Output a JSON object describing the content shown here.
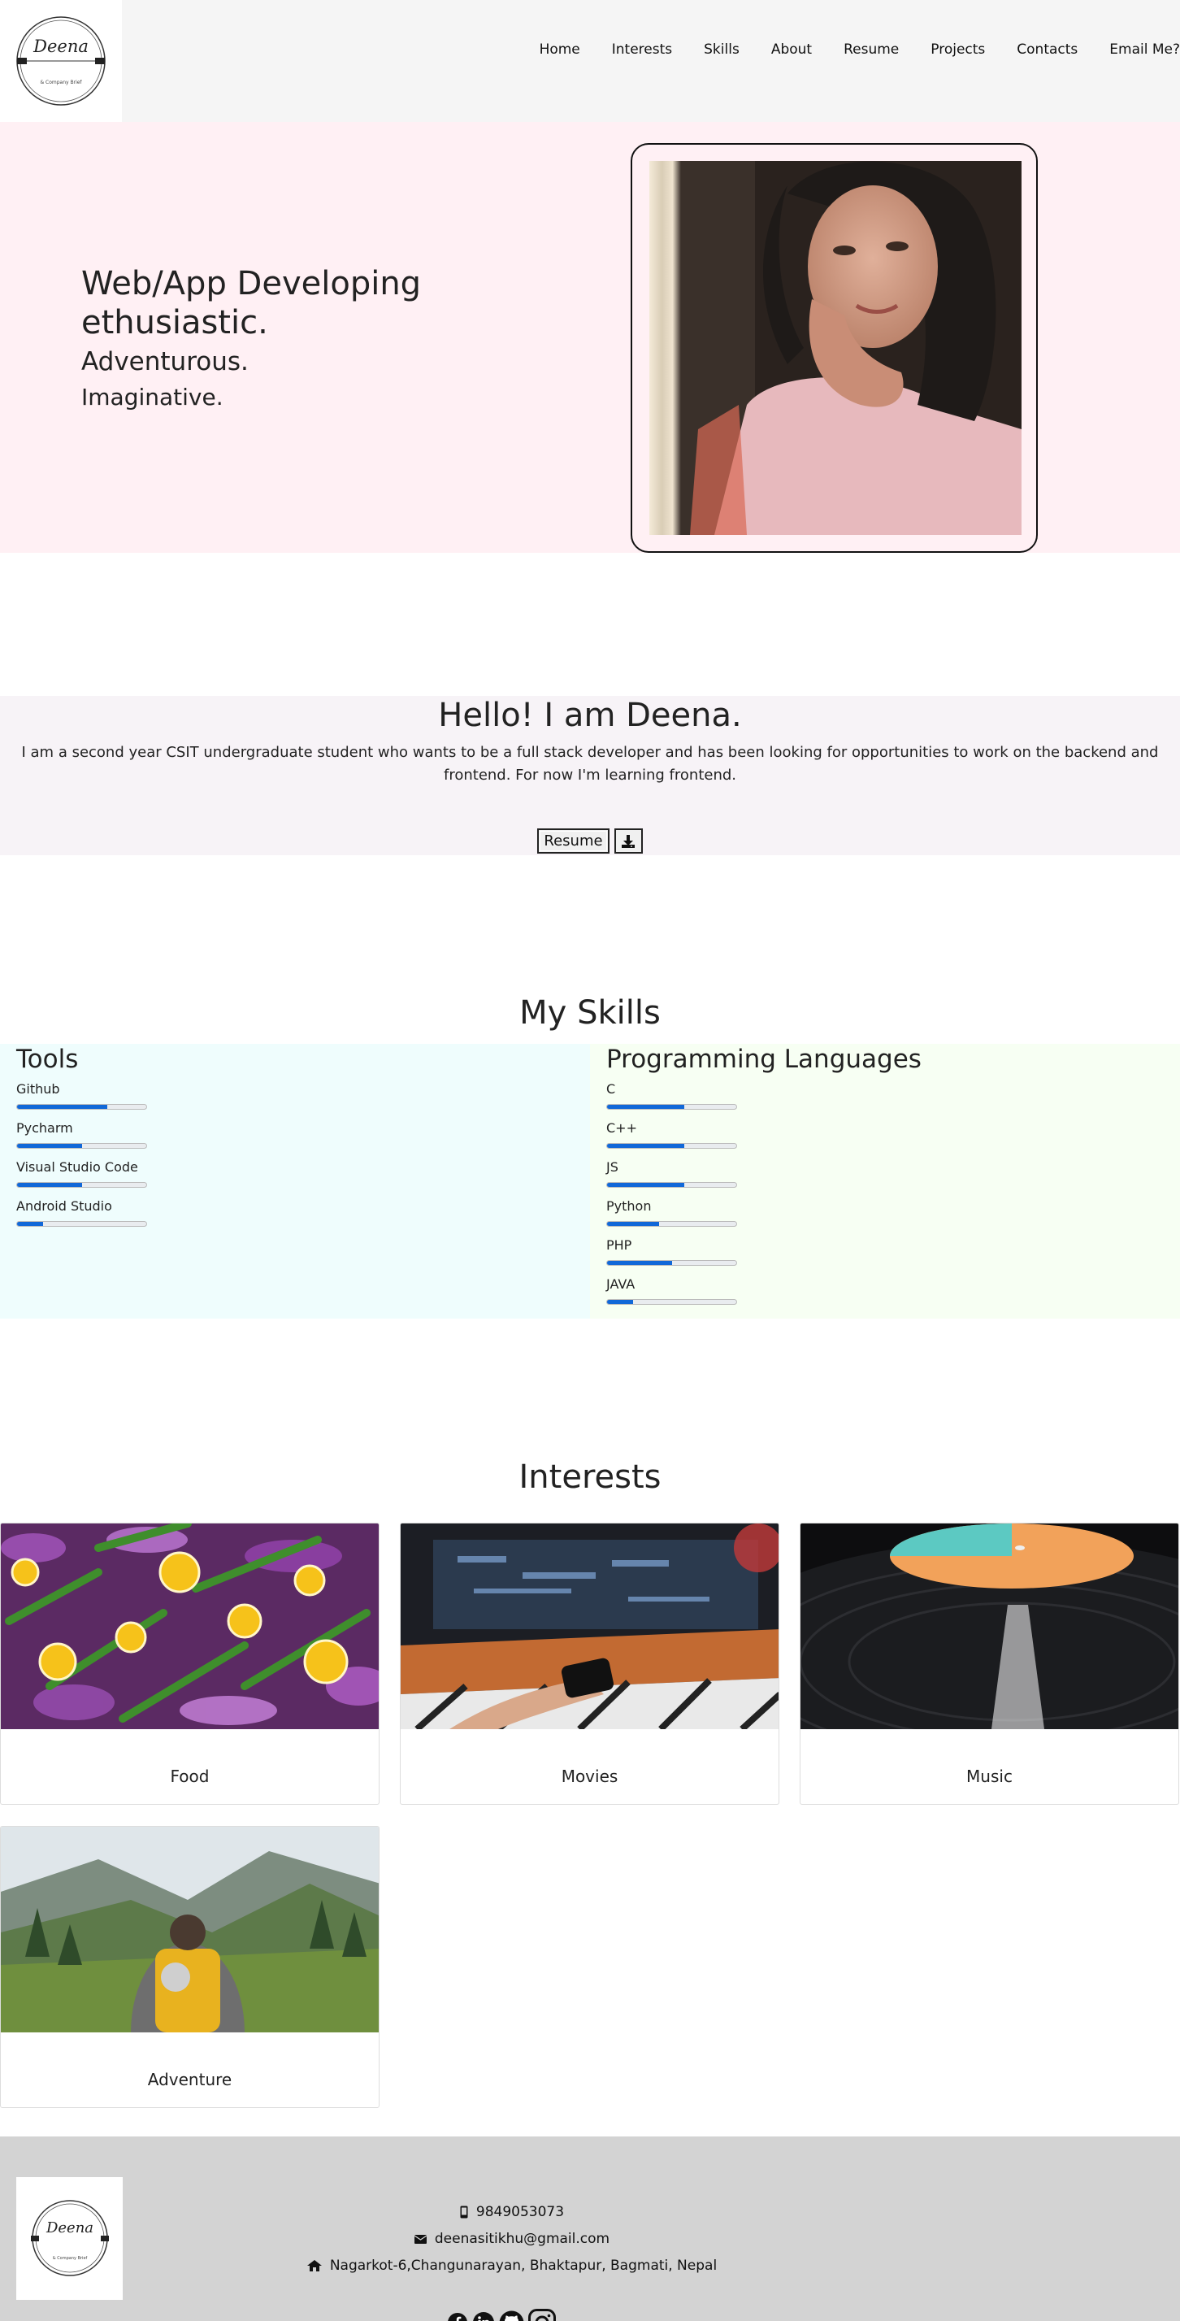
{
  "nav": {
    "logo_text": "Deena",
    "logo_subtext": "& Company Brief",
    "links": [
      "Home",
      "Interests",
      "Skills",
      "About",
      "Resume",
      "Projects",
      "Contacts",
      "Email Me?"
    ]
  },
  "hero": {
    "line1": "Web/App Developing ethusiastic.",
    "line2": "Adventurous.",
    "line3": "Imaginative.",
    "photo_alt": "portrait"
  },
  "about": {
    "title": "Hello! I am Deena.",
    "text": "I am a second year CSIT undergraduate student who wants to be a full stack developer and has been looking for opportunities to work on the backend and frontend. For now I'm learning frontend.",
    "resume_label": "Resume",
    "download_icon": "download-icon"
  },
  "skills": {
    "title": "My Skills",
    "tools": {
      "title": "Tools",
      "items": [
        {
          "name": "Github",
          "level": 0.7
        },
        {
          "name": "Pycharm",
          "level": 0.5
        },
        {
          "name": "Visual Studio Code",
          "level": 0.5
        },
        {
          "name": "Android Studio",
          "level": 0.2
        }
      ]
    },
    "languages": {
      "title": "Programming Languages",
      "items": [
        {
          "name": "C",
          "level": 0.6
        },
        {
          "name": "C++",
          "level": 0.6
        },
        {
          "name": "JS",
          "level": 0.6
        },
        {
          "name": "Python",
          "level": 0.4
        },
        {
          "name": "PHP",
          "level": 0.5
        },
        {
          "name": "JAVA",
          "level": 0.2
        }
      ]
    },
    "bar_color": "#1168d8"
  },
  "interests": {
    "title": "Interests",
    "items": [
      "Food",
      "Movies",
      "Music",
      "Adventure"
    ]
  },
  "footer": {
    "phone": "9849053073",
    "email": "deenasitikhu@gmail.com",
    "address": "Nagarkot-6,Changunarayan, Bhaktapur, Bagmati, Nepal",
    "socials": [
      "facebook-icon",
      "linkedin-icon",
      "github-icon",
      "instagram-icon"
    ]
  }
}
